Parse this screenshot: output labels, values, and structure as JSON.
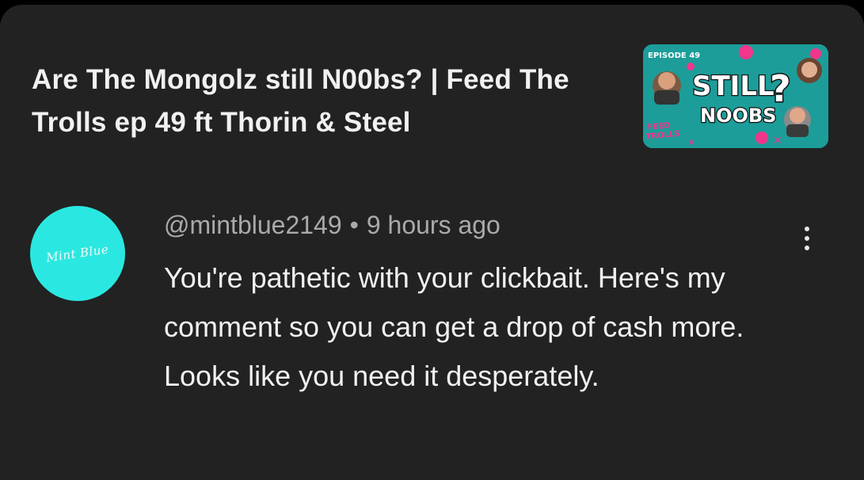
{
  "video": {
    "title": "Are The Mongolz still N00bs? | Feed The Trolls ep 49 ft Thorin & Steel",
    "thumbnail": {
      "episode_text": "EPISODE 49",
      "headline_line1": "STILL",
      "headline_line2": "NOOBS",
      "question_mark": "?",
      "show_logo_line1": "FEED",
      "show_logo_line2": "TROLLS",
      "background_color": "#1fa7a4",
      "accent_color": "#f2368c"
    }
  },
  "comment": {
    "avatar_text": "Mint Blue",
    "avatar_color": "#2ae8e1",
    "author": "@mintblue2149",
    "separator": "•",
    "time": "9 hours ago",
    "text": "You're pathetic with your clickbait. Here's my comment so you can get a drop of cash more. Looks like you need it desperately.",
    "more_icon": "more-vertical-icon"
  }
}
